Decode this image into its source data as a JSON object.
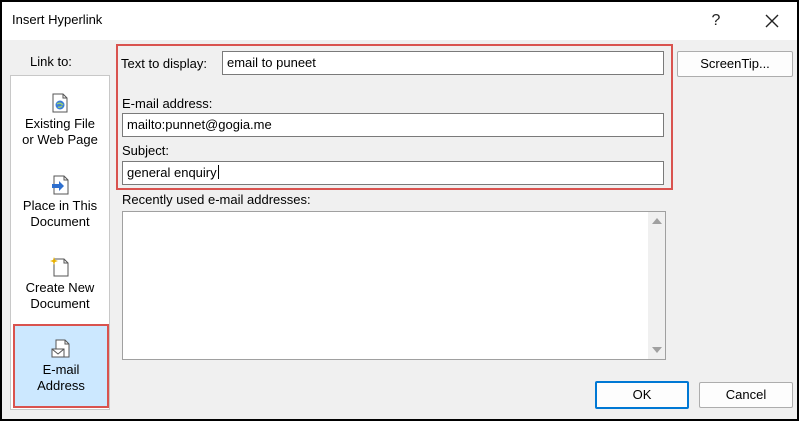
{
  "window": {
    "title": "Insert Hyperlink",
    "help_label": "?"
  },
  "link_to": {
    "label": "Link to:",
    "items": [
      {
        "line1": "Existing File",
        "line2": "or Web Page",
        "icon": "web-page-icon"
      },
      {
        "line1": "Place in This",
        "line2": "Document",
        "icon": "place-in-document-icon"
      },
      {
        "line1": "Create New",
        "line2": "Document",
        "icon": "new-document-icon"
      },
      {
        "line1": "E-mail",
        "line2": "Address",
        "icon": "email-address-icon",
        "selected": true
      }
    ]
  },
  "form": {
    "text_to_display_label": "Text to display:",
    "text_to_display_value": "email to puneet",
    "email_address_label": "E-mail address:",
    "email_address_value": "mailto:punnet@gogia.me",
    "subject_label": "Subject:",
    "subject_value": "general enquiry",
    "recent_label": "Recently used e-mail addresses:"
  },
  "buttons": {
    "screentip": "ScreenTip...",
    "ok": "OK",
    "cancel": "Cancel"
  },
  "colors": {
    "highlight_border": "#d9534f",
    "selected_bg": "#cce8ff",
    "primary_border": "#0078d4"
  }
}
